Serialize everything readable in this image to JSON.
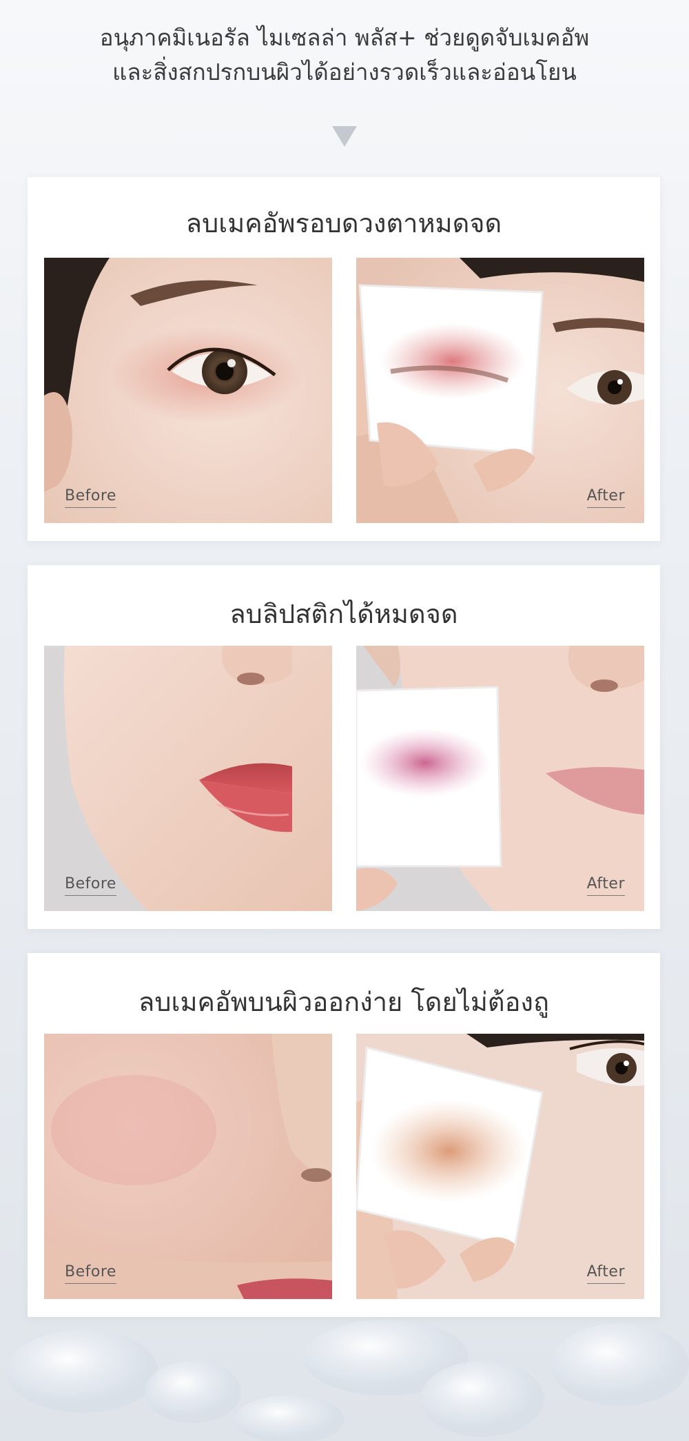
{
  "intro": {
    "line1": "อนุภาคมิเนอรัล ไมเซลล่า พลัส+ ช่วยดูดจับเมคอัพ",
    "line2": "และสิ่งสกปรกบนผิวได้อย่างรวดเร็วและอ่อนโยน"
  },
  "labels": {
    "before": "Before",
    "after": "After"
  },
  "sections": [
    {
      "title": "ลบเมคอัพรอบดวงตาหมดจด"
    },
    {
      "title": "ลบลิปสติกได้หมดจด"
    },
    {
      "title": "ลบเมคอัพบนผิวออกง่าย โดยไม่ต้องถู"
    }
  ],
  "colors": {
    "background": "#e9edf2",
    "card": "#ffffff",
    "text": "#333333",
    "arrow": "#c4c8cf"
  }
}
